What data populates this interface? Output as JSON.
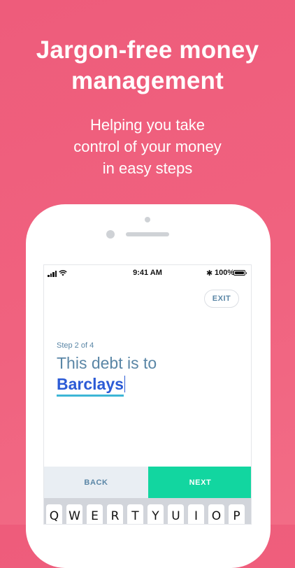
{
  "promo": {
    "headline_line1": "Jargon-free money",
    "headline_line2": "management",
    "subline_line1": "Helping you take",
    "subline_line2": "control of your money",
    "subline_line3": "in easy steps",
    "background_color": "#ef5e7d"
  },
  "status_bar": {
    "time": "9:41 AM",
    "bluetooth_icon": "bluetooth-icon",
    "battery_percent": "100%"
  },
  "app": {
    "exit_label": "EXIT",
    "step_label": "Step 2 of 4",
    "prompt": "This debt is to",
    "answer": "Barclays",
    "back_label": "BACK",
    "next_label": "NEXT",
    "colors": {
      "text_blue": "#5a86a6",
      "answer_blue": "#2c5bd6",
      "underline": "#3db6d6",
      "next_green": "#12d6a0",
      "back_bg": "#e9eef3"
    }
  },
  "keyboard": {
    "keys": [
      "Q",
      "W",
      "E",
      "R",
      "T",
      "Y",
      "U",
      "I",
      "O",
      "P"
    ]
  }
}
